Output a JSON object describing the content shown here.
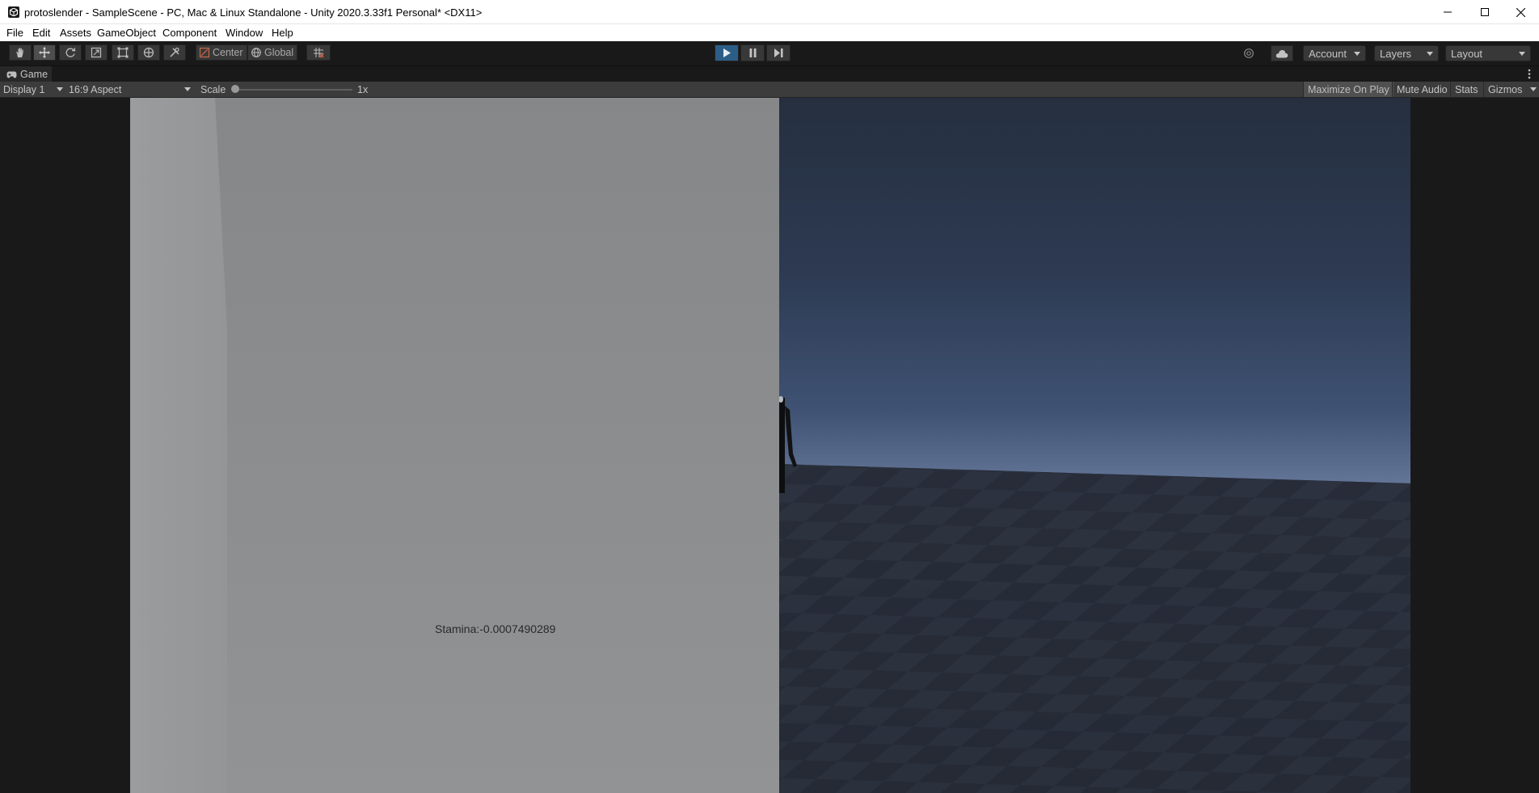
{
  "window": {
    "title": "protoslender - SampleScene - PC, Mac & Linux Standalone - Unity 2020.3.33f1 Personal* <DX11>"
  },
  "menu": {
    "items": [
      "File",
      "Edit",
      "Assets",
      "GameObject",
      "Component",
      "Window",
      "Help"
    ]
  },
  "toolbar": {
    "tools": [
      "hand-tool",
      "move-tool",
      "rotate-tool",
      "scale-tool",
      "rect-tool",
      "transform-tool",
      "custom-tool"
    ],
    "pivot_mode": "Center",
    "pivot_rotation": "Global",
    "playing": true,
    "account_label": "Account",
    "layers_label": "Layers",
    "layout_label": "Layout",
    "play_color": "#2c5d87"
  },
  "game_tab": {
    "label": "Game"
  },
  "game_bar": {
    "display": "Display 1",
    "aspect": "16:9 Aspect",
    "scale_label": "Scale",
    "scale_value": "1x",
    "maximize_on_play": "Maximize On Play",
    "mute_audio": "Mute Audio",
    "stats": "Stats",
    "gizmos": "Gizmos"
  },
  "game_view": {
    "hud_text": "Stamina:-0.0007490289"
  }
}
